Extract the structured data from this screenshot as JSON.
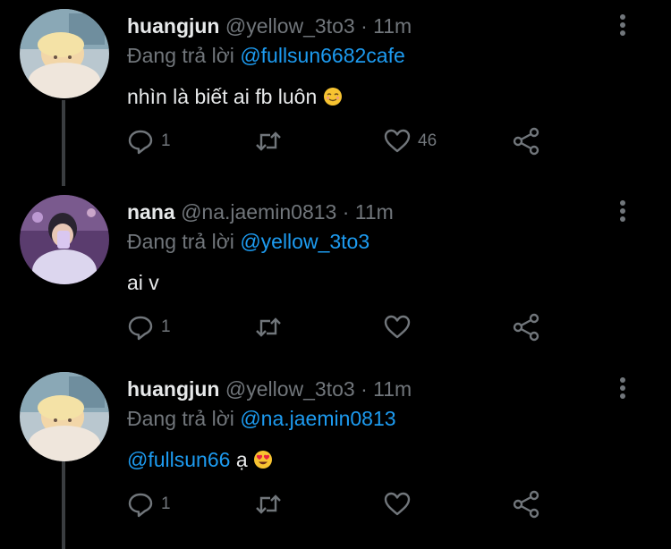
{
  "colors": {
    "background": "#000000",
    "text_primary": "#e7e9ea",
    "text_secondary": "#71767b",
    "accent": "#1d9bf0",
    "thread_line": "#3a3d40"
  },
  "tweets": [
    {
      "name": "huangjun",
      "handle": "@yellow_3to3",
      "separator": "·",
      "time": "11m",
      "reply_prefix": "Đang trả lời",
      "reply_to": "@fullsun6682cafe",
      "text": "nhìn là biết ai fb luôn",
      "emoji_icon": "relieved-face-emoji",
      "reply_count": "1",
      "like_count": "46"
    },
    {
      "name": "nana",
      "handle": "@na.jaemin0813",
      "separator": "·",
      "time": "11m",
      "reply_prefix": "Đang trả lời",
      "reply_to": "@yellow_3to3",
      "text": "ai v",
      "reply_count": "1",
      "like_count": ""
    },
    {
      "name": "huangjun",
      "handle": "@yellow_3to3",
      "separator": "·",
      "time": "11m",
      "reply_prefix": "Đang trả lời",
      "reply_to": "@na.jaemin0813",
      "text_mention": "@fullsun66",
      "text": "ạ",
      "emoji_icon": "heart-eyes-emoji",
      "reply_count": "1",
      "like_count": ""
    }
  ],
  "icons": [
    "reply-icon",
    "retweet-icon",
    "like-icon",
    "share-icon",
    "more-options-icon"
  ]
}
